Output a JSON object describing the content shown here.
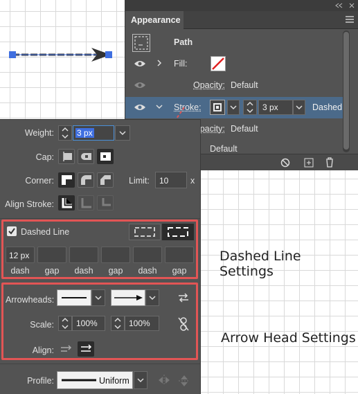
{
  "appearance": {
    "title": "Appearance",
    "path_label": "Path",
    "fill_label": "Fill:",
    "opacity_label": "Opacity:",
    "opacity_value": "Default",
    "stroke_label": "Stroke:",
    "stroke_weight": "3 px",
    "stroke_style": "Dashed",
    "opacity2_label": "Opacity:",
    "opacity2_value": "Default",
    "opacity3_label": "y:",
    "opacity3_value": "Default"
  },
  "stroke": {
    "weight_label": "Weight:",
    "weight_value": "3 px",
    "cap_label": "Cap:",
    "corner_label": "Corner:",
    "limit_label": "Limit:",
    "limit_value": "10",
    "limit_unit": "x",
    "align_label": "Align Stroke:",
    "dashed_label": "Dashed Line",
    "dashed_checked": true,
    "dash_values": [
      "12 px",
      "",
      "",
      "",
      "",
      ""
    ],
    "dash_labels": [
      "dash",
      "gap",
      "dash",
      "gap",
      "dash",
      "gap"
    ],
    "arrowheads_label": "Arrowheads:",
    "scale_label": "Scale:",
    "scale_start": "100%",
    "scale_end": "100%",
    "align2_label": "Align:",
    "profile_label": "Profile:",
    "profile_value": "Uniform"
  },
  "annotations": {
    "dashed_settings": "Dashed Line Settings",
    "arrow_settings": "Arrow Head Settings"
  },
  "colors": {
    "panel_bg": "#535353",
    "highlight": "#4b6a8a",
    "annotation_red": "#e25555",
    "selection_blue": "#3f6fe0"
  },
  "icons": [
    "eye-icon",
    "chevron-down-icon",
    "trash-icon",
    "add-icon",
    "clear-icon",
    "swap-icon",
    "link-icon",
    "menu-icon",
    "collapse-icon"
  ]
}
